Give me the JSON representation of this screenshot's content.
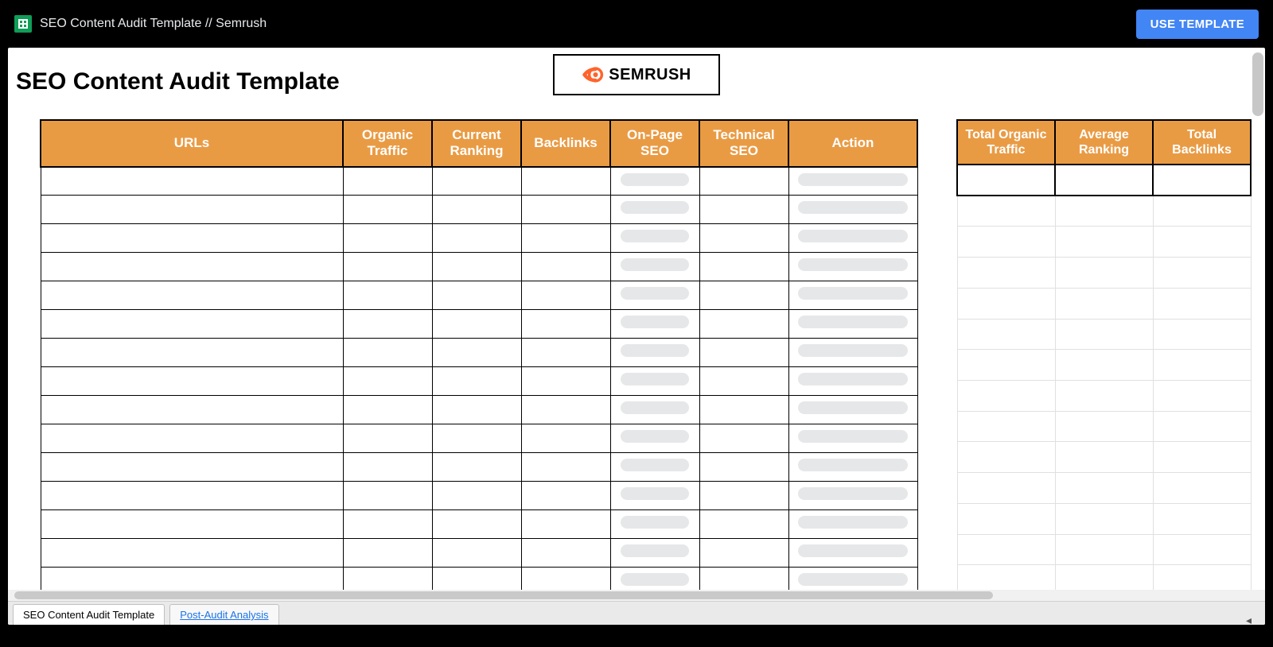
{
  "topbar": {
    "doc_title": "SEO Content Audit Template // Semrush",
    "use_template_label": "USE TEMPLATE"
  },
  "header": {
    "page_title": "SEO Content Audit Template",
    "logo_text": "SEMRUSH"
  },
  "main_table": {
    "headers": {
      "urls": "URLs",
      "organic_traffic": "Organic Traffic",
      "current_ranking": "Current Ranking",
      "backlinks": "Backlinks",
      "onpage_seo": "On-Page SEO",
      "technical_seo": "Technical SEO",
      "action": "Action"
    },
    "row_count": 15
  },
  "summary_table": {
    "headers": {
      "total_organic_traffic": "Total Organic Traffic",
      "average_ranking": "Average Ranking",
      "total_backlinks": "Total Backlinks"
    },
    "row_count": 14
  },
  "tabs": {
    "tab1": "SEO Content Audit Template",
    "tab2": "Post-Audit Analysis"
  }
}
